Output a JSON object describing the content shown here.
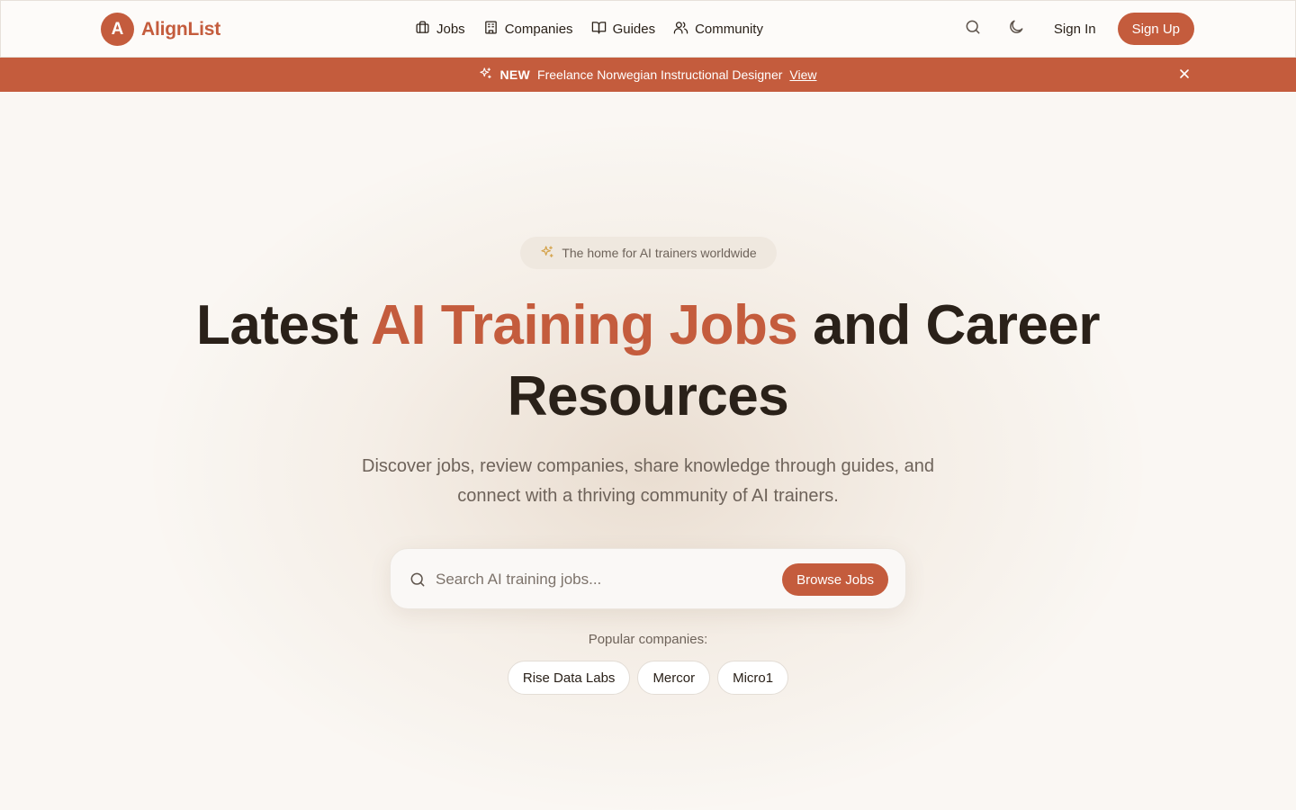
{
  "brand": {
    "logo_letter": "A",
    "name": "AlignList",
    "accent_color": "#c45c3d"
  },
  "nav": {
    "links": [
      {
        "label": "Jobs",
        "icon": "briefcase-icon"
      },
      {
        "label": "Companies",
        "icon": "building-icon"
      },
      {
        "label": "Guides",
        "icon": "book-open-icon"
      },
      {
        "label": "Community",
        "icon": "users-icon"
      }
    ],
    "search_icon": "search-icon",
    "theme_icon": "moon-icon",
    "sign_in": "Sign In",
    "sign_up": "Sign Up"
  },
  "banner": {
    "icon": "sparkles-icon",
    "tag": "NEW",
    "text": "Freelance Norwegian Instructional Designer",
    "link": "View",
    "close_icon": "close-icon"
  },
  "hero": {
    "pill": {
      "icon": "sparkles-icon",
      "text": "The home for AI trainers worldwide"
    },
    "title_before": "Latest ",
    "title_accent": "AI Training Jobs",
    "title_after": " and Career Resources",
    "subtitle": "Discover jobs, review companies, share knowledge through guides, and connect with a thriving community of AI trainers.",
    "search": {
      "placeholder": "Search AI training jobs...",
      "value": "",
      "button": "Browse Jobs"
    },
    "popular_label": "Popular companies:",
    "popular_companies": [
      "Rise Data Labs",
      "Mercor",
      "Micro1"
    ]
  }
}
